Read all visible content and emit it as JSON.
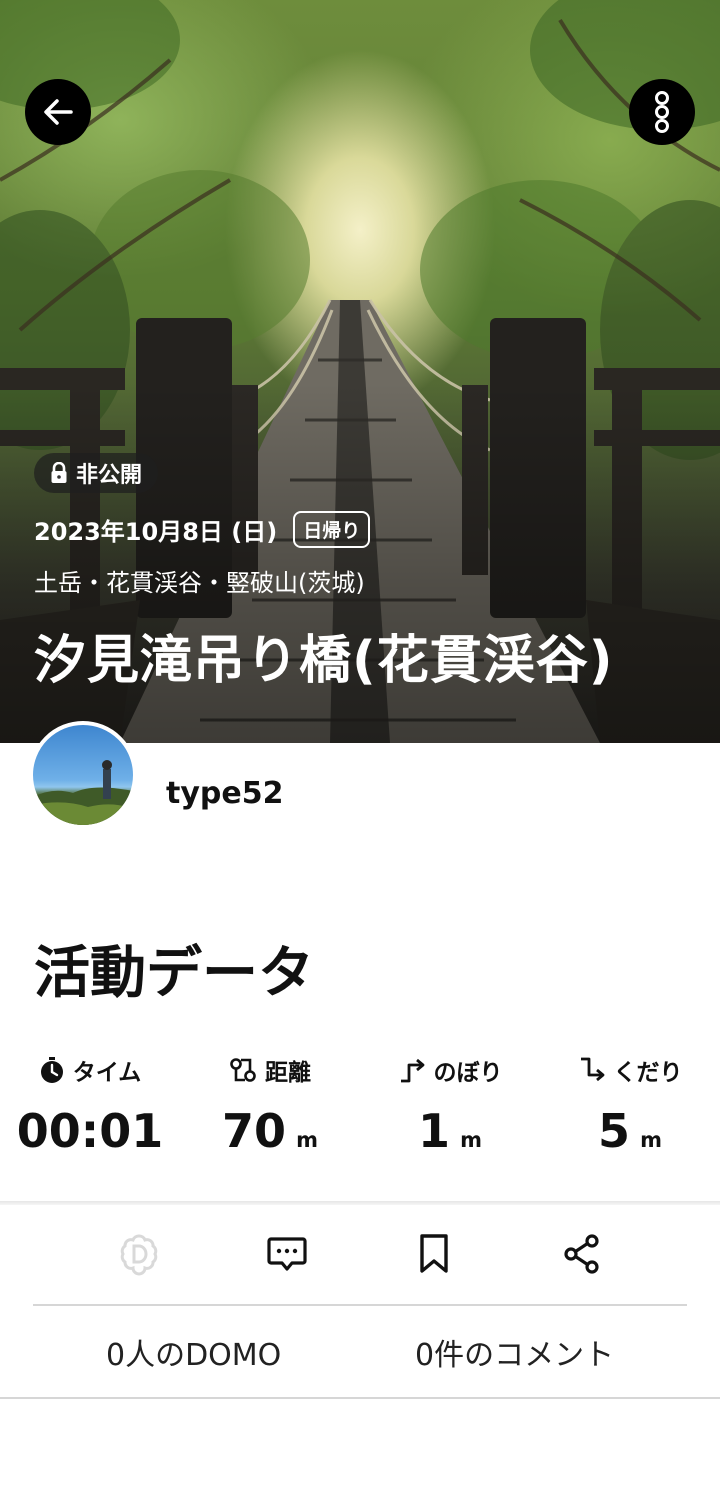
{
  "header": {
    "back_icon": "arrow-left-icon",
    "more_icon": "more-vertical-icon",
    "privacy": {
      "icon": "lock-icon",
      "label": "非公開"
    },
    "date": "2023年10月8日 (日)",
    "trip_type": "日帰り",
    "area": "土岳・花貫渓谷・竪破山(茨城)",
    "title": "汐見滝吊り橋(花貫渓谷)"
  },
  "user": {
    "name": "type52"
  },
  "activity": {
    "title": "活動データ",
    "stats": [
      {
        "icon": "stopwatch-icon",
        "label": "タイム",
        "value": "00:01",
        "unit": ""
      },
      {
        "icon": "route-icon",
        "label": "距離",
        "value": "70",
        "unit": "m"
      },
      {
        "icon": "ascent-icon",
        "label": "のぼり",
        "value": "1",
        "unit": "m"
      },
      {
        "icon": "descent-icon",
        "label": "くだり",
        "value": "5",
        "unit": "m"
      }
    ]
  },
  "actions": {
    "domo_icon": "domo-icon",
    "comment_icon": "comment-icon",
    "bookmark_icon": "bookmark-icon",
    "share_icon": "share-icon"
  },
  "counts": {
    "domo": "0人のDOMO",
    "comments": "0件のコメント"
  },
  "colors": {
    "button_bg": "#000000",
    "domo_icon_disabled": "#d9d9d9",
    "divider": "#d6d6d6"
  }
}
